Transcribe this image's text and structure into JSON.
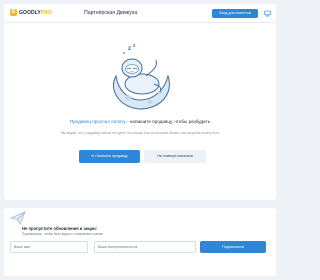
{
  "header": {
    "logo_letter": "G",
    "logo_text": "GOODLY",
    "logo_pro": "PRO",
    "title": "Партнёрская Движуха",
    "cta_label": "Вход для клиентов"
  },
  "main": {
    "headline_link": "Продавец проспал оплату",
    "headline_rest": " - напишите продавцу, чтобы разбудить",
    "subtext": "Мы видим, что у продавца сейчас нет денег на покупку. Как он пополнит баланс, мы запустим оплату бота",
    "primary_button": "Написать продавцу",
    "secondary_button": "На главную магазина"
  },
  "subscribe": {
    "title": "Не пропустите обновления и акции:",
    "subtitle": "Подпишитесь, чтобы быть вкурсе и оперативно узнать",
    "name_placeholder": "Ваше имя",
    "email_placeholder": "Ваша электронная почта",
    "button_label": "Подписаться"
  },
  "colors": {
    "accent": "#2f86d6",
    "logo_yellow": "#f5b82e",
    "background": "#eef1f5"
  },
  "icons": [
    "monitor-icon",
    "sleeping-sloth-illustration",
    "message-icon",
    "paper-plane-icon"
  ]
}
